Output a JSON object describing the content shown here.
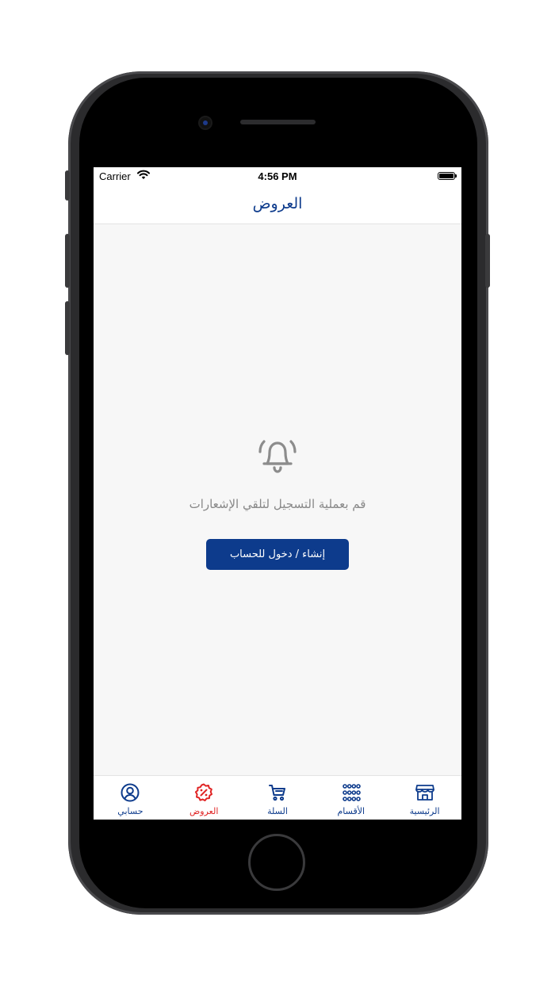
{
  "status_bar": {
    "carrier": "Carrier",
    "time": "4:56 PM"
  },
  "nav": {
    "title": "العروض"
  },
  "empty_state": {
    "message": "قم بعملية التسجيل لتلقي الإشعارات",
    "button_label": "إنشاء / دخول للحساب",
    "icon": "bell-icon"
  },
  "tabs": [
    {
      "label": "حسابي",
      "icon": "account-icon",
      "active": false
    },
    {
      "label": "العروض",
      "icon": "offers-icon",
      "active": true
    },
    {
      "label": "السلة",
      "icon": "cart-icon",
      "active": false
    },
    {
      "label": "الأقسام",
      "icon": "grid-icon",
      "active": false
    },
    {
      "label": "الرئيسية",
      "icon": "store-icon",
      "active": false
    }
  ],
  "colors": {
    "primary": "#0d3b8c",
    "active_tab": "#e02424",
    "muted_text": "#888888",
    "background": "#f7f7f7"
  }
}
